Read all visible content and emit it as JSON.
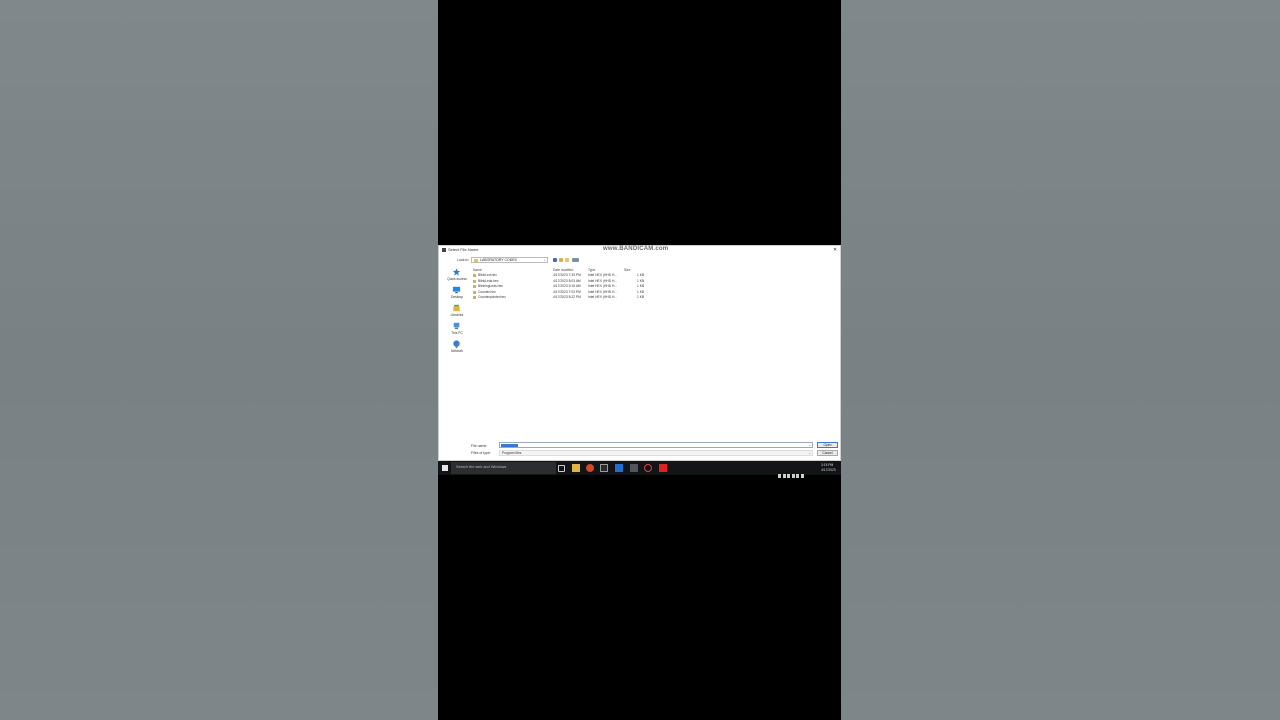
{
  "dialog": {
    "title": "Select File Name",
    "watermark": "www.BANDICAM.com",
    "close": "✕",
    "look_in_label": "Look in:",
    "look_in_value": "LABORATORY CODES"
  },
  "places": [
    {
      "label": "Quick access",
      "color": "#2a79d6"
    },
    {
      "label": "Desktop",
      "color": "#1e88e5"
    },
    {
      "label": "Libraries",
      "color": "#e3b43c"
    },
    {
      "label": "This PC",
      "color": "#4a90d9"
    },
    {
      "label": "Network",
      "color": "#3c7fc9"
    }
  ],
  "columns": {
    "name": "Name",
    "date": "Date modified",
    "type": "Type",
    "size": "Size"
  },
  "files": [
    {
      "name": "BlinkLed.hex",
      "date": "4/17/2023 7:33 PM",
      "type": "Intel HEX (HHD H...",
      "size": "1 KB"
    },
    {
      "name": "BlinkLeds.hex",
      "date": "4/17/2023 8:03 AM",
      "type": "Intel HEX (HHD H...",
      "size": "1 KB"
    },
    {
      "name": "BlinkingLeds.hex",
      "date": "4/17/2023 9:15 AM",
      "type": "Intel HEX (HHD H...",
      "size": "1 KB"
    },
    {
      "name": "Counter.hex",
      "date": "4/17/2023 7:03 PM",
      "type": "Intel HEX (HHD H...",
      "size": "1 KB"
    },
    {
      "name": "Counterpointer.hex",
      "date": "4/17/2023 8:22 PM",
      "type": "Intel HEX (HHD H...",
      "size": "1 KB"
    }
  ],
  "footer": {
    "file_name_label": "File name:",
    "file_name_value": "",
    "file_type_label": "Files of type:",
    "file_type_value": "Program files",
    "open_button": "Open",
    "cancel_button": "Cancel"
  },
  "taskbar": {
    "search_placeholder": "Search the web and Windows",
    "time": "3:15 PM",
    "date": "4/17/2023"
  }
}
